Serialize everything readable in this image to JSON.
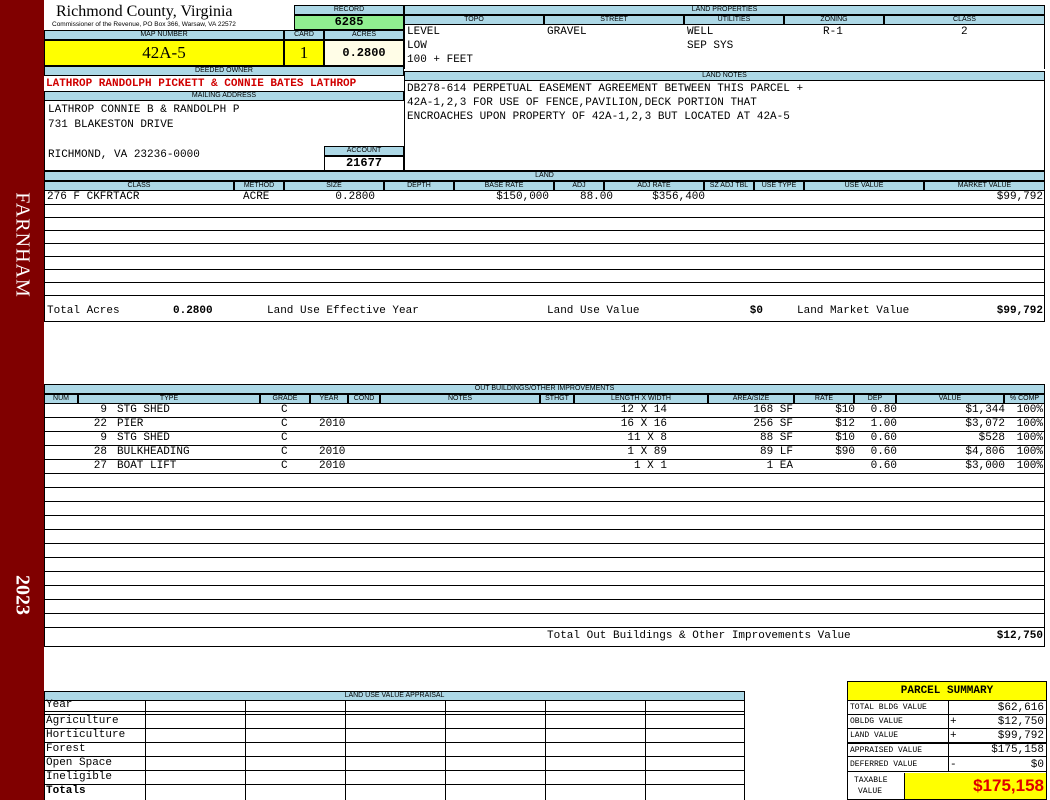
{
  "sidebar": {
    "district": "FARNHAM",
    "year": "2023"
  },
  "header": {
    "county": "Richmond County, Virginia",
    "commissioner": "Commissioner of the Revenue, PO Box 366, Warsaw, VA 22572",
    "record_label": "RECORD",
    "record": "6285",
    "map_number_label": "MAP NUMBER",
    "map_number": "42A-5",
    "card_label": "CARD",
    "card": "1",
    "acres_label": "ACRES",
    "acres": "0.2800"
  },
  "owner": {
    "deeded_owner_label": "DEEDED OWNER",
    "deeded_owner": "LATHROP RANDOLPH PICKETT & CONNIE BATES LATHROP",
    "mailing_label": "MAILING ADDRESS",
    "mailing_lines": [
      "LATHROP CONNIE B & RANDOLPH P",
      "731 BLAKESTON DRIVE",
      "",
      "RICHMOND, VA 23236-0000"
    ],
    "account_label": "ACCOUNT",
    "account": "21677"
  },
  "land_properties": {
    "title": "LAND PROPERTIES",
    "columns": [
      "TOPO",
      "STREET",
      "UTILITIES",
      "ZONING",
      "CLASS"
    ],
    "rows": [
      [
        "LEVEL",
        "GRAVEL",
        "WELL",
        "R-1",
        "2"
      ],
      [
        "LOW",
        "",
        "SEP SYS",
        "",
        ""
      ],
      [
        "100 + FEET",
        "",
        "",
        "",
        ""
      ]
    ]
  },
  "land_notes": {
    "title": "LAND NOTES",
    "lines": [
      "DB278-614 PERPETUAL EASEMENT AGREEMENT BETWEEN THIS PARCEL +",
      "42A-1,2,3 FOR USE OF FENCE,PAVILION,DECK PORTION THAT",
      "ENCROACHES UPON PROPERTY OF 42A-1,2,3 BUT LOCATED AT 42A-5"
    ]
  },
  "land": {
    "title": "LAND",
    "columns": [
      "CLASS",
      "METHOD",
      "SIZE",
      "DEPTH",
      "BASE RATE",
      "ADJ",
      "ADJ RATE",
      "SZ ADJ TBL",
      "USE TYPE",
      "USE VALUE",
      "MARKET VALUE"
    ],
    "rows": [
      [
        "276 F CKFRTACR",
        "ACRE",
        "0.2800",
        "",
        "$150,000",
        "88.00",
        "$356,400",
        "",
        "",
        "",
        "$99,792"
      ]
    ],
    "total_acres_label": "Total Acres",
    "total_acres": "0.2800",
    "effective_year_label": "Land Use Effective Year",
    "effective_year": "",
    "use_value_label": "Land Use Value",
    "use_value": "$0",
    "market_value_label": "Land Market Value",
    "market_value": "$99,792"
  },
  "outbuildings": {
    "title": "OUT BUILDINGS/OTHER IMPROVEMENTS",
    "columns": [
      "NUM",
      "TYPE",
      "GRADE",
      "YEAR",
      "COND",
      "NOTES",
      "STHGT",
      "LENGTH X WIDTH",
      "AREA/SIZE",
      "RATE",
      "DEP",
      "VALUE",
      "% COMP"
    ],
    "rows": [
      [
        "9",
        "STG SHED",
        "C",
        "",
        "",
        "",
        "",
        "12 X 14",
        "168 SF",
        "$10",
        "0.80",
        "$1,344",
        "100%"
      ],
      [
        "22",
        "PIER",
        "C",
        "2010",
        "",
        "",
        "",
        "16 X 16",
        "256 SF",
        "$12",
        "1.00",
        "$3,072",
        "100%"
      ],
      [
        "9",
        "STG SHED",
        "C",
        "",
        "",
        "",
        "",
        "11 X 8",
        "88 SF",
        "$10",
        "0.60",
        "$528",
        "100%"
      ],
      [
        "28",
        "BULKHEADING",
        "C",
        "2010",
        "",
        "",
        "",
        "1 X 89",
        "89 LF",
        "$90",
        "0.60",
        "$4,806",
        "100%"
      ],
      [
        "27",
        "BOAT LIFT",
        "C",
        "2010",
        "",
        "",
        "",
        "1 X 1",
        "1 EA",
        "",
        "0.60",
        "$3,000",
        "100%"
      ]
    ],
    "total_label": "Total Out Buildings & Other Improvements Value",
    "total": "$12,750"
  },
  "land_use_appraisal": {
    "title": "LAND USE VALUE APPRAISAL",
    "rows": [
      "Year",
      "Agriculture",
      "Horticulture",
      "Forest",
      "Open Space",
      "Ineligible",
      "Totals"
    ]
  },
  "parcel_summary": {
    "title": "PARCEL SUMMARY",
    "items": [
      {
        "label": "TOTAL BLDG VALUE",
        "sign": "",
        "value": "$62,616"
      },
      {
        "label": "OBLDG VALUE",
        "sign": "+",
        "value": "$12,750"
      },
      {
        "label": "LAND VALUE",
        "sign": "+",
        "value": "$99,792"
      },
      {
        "label": "APPRAISED VALUE",
        "sign": "",
        "value": "$175,158"
      },
      {
        "label": "DEFERRED VALUE",
        "sign": "-",
        "value": "$0"
      }
    ],
    "taxable_label_1": "TAXABLE",
    "taxable_label_2": "VALUE",
    "taxable_value": "$175,158"
  }
}
